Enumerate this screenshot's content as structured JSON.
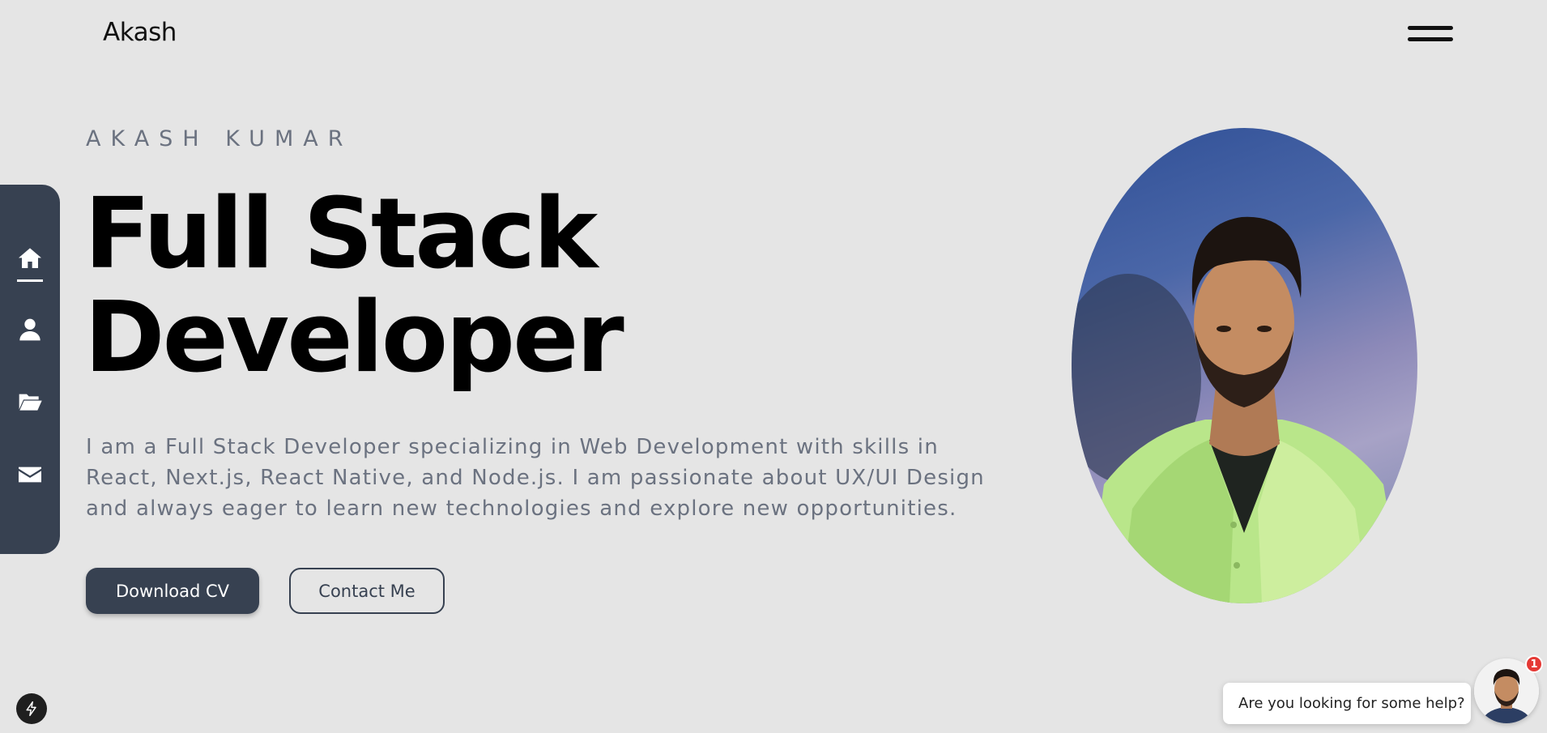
{
  "header": {
    "logo_text": "Akash",
    "menu_icon": "hamburger-menu-icon"
  },
  "sidenav": {
    "items": [
      {
        "icon": "home-icon",
        "active": true
      },
      {
        "icon": "user-icon",
        "active": false
      },
      {
        "icon": "folder-icon",
        "active": false
      },
      {
        "icon": "mail-icon",
        "active": false
      }
    ],
    "background": "#374151"
  },
  "hero": {
    "kicker": "AKASH KUMAR",
    "title_line1": "Full Stack",
    "title_line2": "Developer",
    "description": "I am a Full Stack Developer specializing in Web Development with skills in React, Next.js, React Native, and Node.js. I am passionate about UX/UI Design and always eager to learn new technologies and explore new opportunities.",
    "primary_button": "Download CV",
    "secondary_button": "Contact Me"
  },
  "chat": {
    "message": "Are you looking for some help?",
    "badge_count": "1"
  },
  "colors": {
    "background": "#e5e5e5",
    "accent": "#374151",
    "muted_text": "#6b7280",
    "badge": "#e53935"
  }
}
